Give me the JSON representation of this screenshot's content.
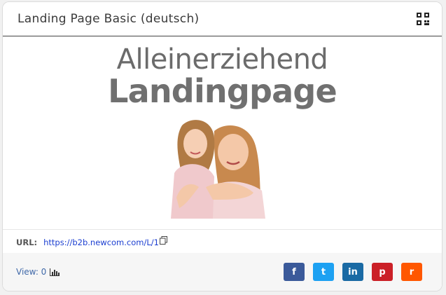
{
  "card": {
    "title": "Landing Page Basic (deutsch)"
  },
  "icons": {
    "qr": "qr-code-icon",
    "copy": "copy-icon",
    "chart": "bar-chart-icon"
  },
  "preview": {
    "headline_top": "Alleinerziehend",
    "headline_main": "Landingpage",
    "image_alt": "mother-and-daughter-photo"
  },
  "url": {
    "label": "URL:",
    "value": "https://b2b.newcom.com/L/1"
  },
  "footer": {
    "views_label": "View: 0",
    "share": [
      {
        "name": "facebook",
        "glyph": "f",
        "color": "#3b5a9a"
      },
      {
        "name": "twitter",
        "glyph": "t",
        "color": "#1da1f2"
      },
      {
        "name": "linkedin",
        "glyph": "in",
        "color": "#1a6aa4"
      },
      {
        "name": "pinterest",
        "glyph": "p",
        "color": "#cb2027"
      },
      {
        "name": "reddit",
        "glyph": "r",
        "color": "#ff5700"
      }
    ]
  }
}
